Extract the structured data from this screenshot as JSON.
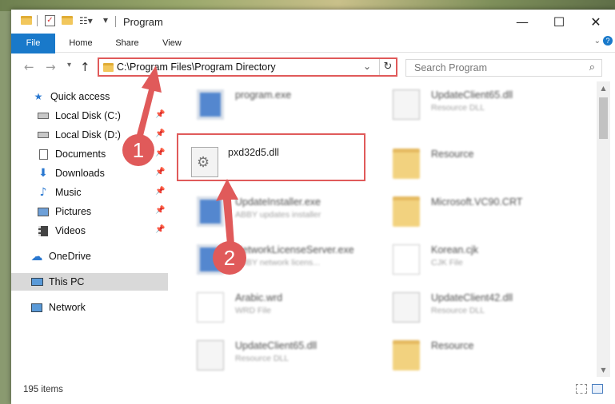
{
  "window": {
    "title": "Program",
    "minimize": "—",
    "maximize": "☐",
    "close": "✕"
  },
  "ribbon": {
    "tabs": [
      "File",
      "Home",
      "Share",
      "View"
    ]
  },
  "address": {
    "path": "C:\\Program Files\\Program Directory",
    "search_placeholder": "Search Program"
  },
  "sidebar": {
    "quick_access": "Quick access",
    "items": [
      {
        "label": "Local Disk (C:)",
        "icon": "drive-icon",
        "pinned": true
      },
      {
        "label": "Local Disk (D:)",
        "icon": "drive-icon",
        "pinned": true
      },
      {
        "label": "Documents",
        "icon": "documents-icon",
        "pinned": true
      },
      {
        "label": "Downloads",
        "icon": "download-icon",
        "pinned": true
      },
      {
        "label": "Music",
        "icon": "music-icon",
        "pinned": true
      },
      {
        "label": "Pictures",
        "icon": "pictures-icon",
        "pinned": true
      },
      {
        "label": "Videos",
        "icon": "videos-icon",
        "pinned": true
      }
    ],
    "onedrive": "OneDrive",
    "this_pc": "This PC",
    "network": "Network"
  },
  "files": [
    {
      "name": "program.exe",
      "desc": "",
      "type": "exe-icon"
    },
    {
      "name": "UpdateClient65.dll",
      "desc": "Resource DLL",
      "type": "dll-icon"
    },
    {
      "name": "pxd32d5.dll",
      "desc": "",
      "type": "dll-icon"
    },
    {
      "name": "Resource",
      "desc": "",
      "type": "folder-icon"
    },
    {
      "name": "UpdateInstaller.exe",
      "desc": "ABBY updates installer",
      "type": "exe-icon"
    },
    {
      "name": "Microsoft.VC90.CRT",
      "desc": "",
      "type": "folder-icon"
    },
    {
      "name": "NetworkLicenseServer.exe",
      "desc": "ABBY network licens...",
      "type": "exe-icon"
    },
    {
      "name": "Korean.cjk",
      "desc": "CJK File",
      "type": "file-icon"
    },
    {
      "name": "Arabic.wrd",
      "desc": "WRD File",
      "type": "file-icon"
    },
    {
      "name": "UpdateClient42.dll",
      "desc": "Resource DLL",
      "type": "dll-icon"
    },
    {
      "name": "UpdateClient65.dll",
      "desc": "Resource DLL",
      "type": "dll-icon"
    },
    {
      "name": "Resource",
      "desc": "",
      "type": "folder-icon"
    }
  ],
  "status": {
    "items_count": "195 items"
  },
  "annotations": {
    "step1": "1",
    "step2": "2",
    "color": "#e05a5a"
  }
}
